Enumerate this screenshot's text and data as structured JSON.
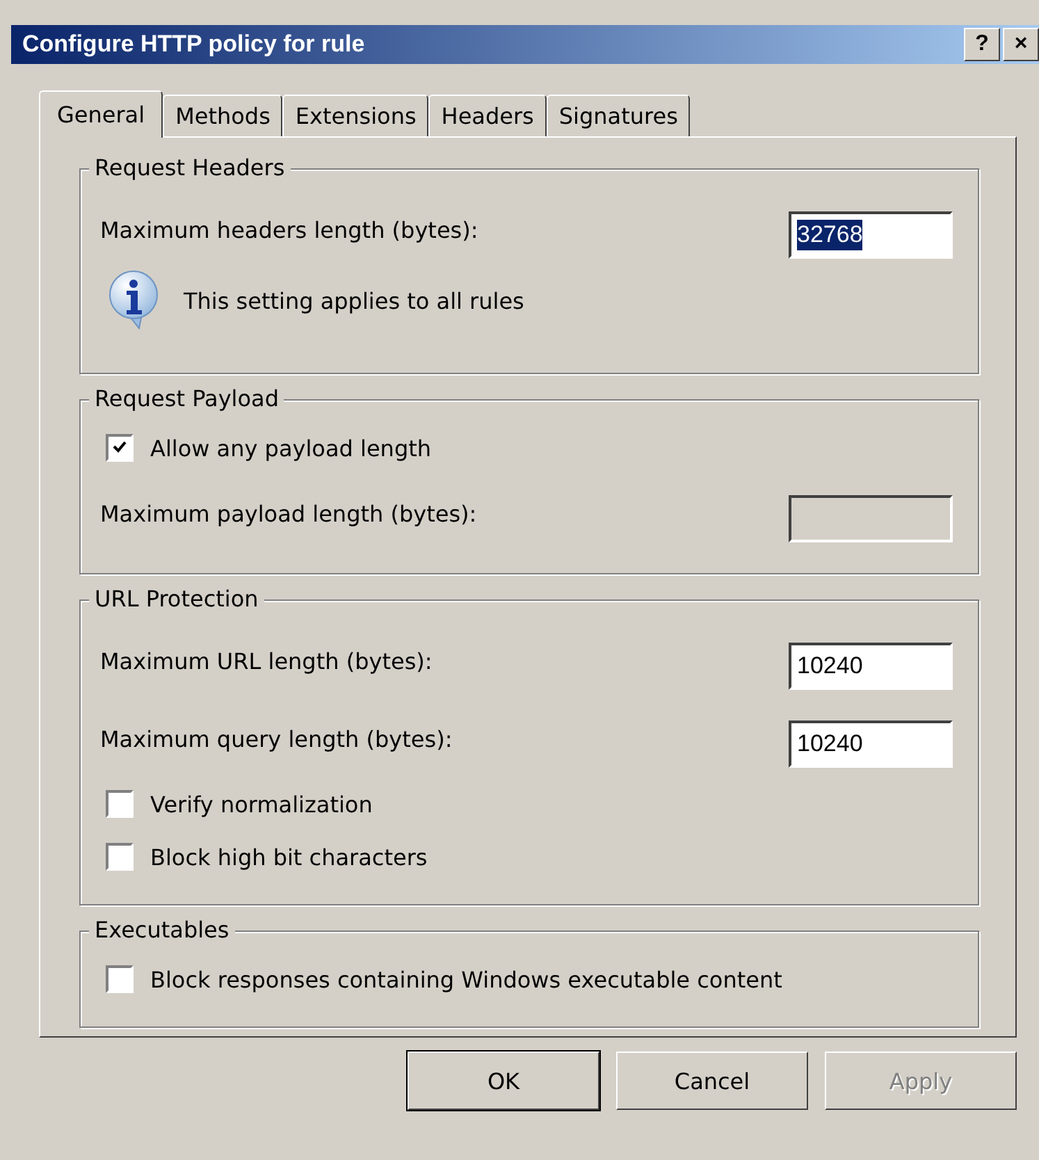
{
  "window": {
    "title": "Configure HTTP policy for rule",
    "title_buttons": [
      "?",
      "×"
    ]
  },
  "tabs": [
    {
      "label": "General",
      "selected": true
    },
    {
      "label": "Methods",
      "selected": false
    },
    {
      "label": "Extensions",
      "selected": false
    },
    {
      "label": "Headers",
      "selected": false
    },
    {
      "label": "Signatures",
      "selected": false
    }
  ],
  "groups": [
    {
      "title": "Request Headers",
      "rows": [
        {
          "kind": "field",
          "label": "Maximum headers length (bytes):",
          "value": "32768",
          "value_selected": true,
          "disabled": false
        },
        {
          "kind": "info",
          "text": "This setting applies to all rules"
        }
      ]
    },
    {
      "title": "Request Payload",
      "rows": [
        {
          "kind": "checkbox",
          "label": "Allow any payload length",
          "checked": true
        },
        {
          "kind": "field",
          "label": "Maximum payload length (bytes):",
          "disabled": true
        }
      ]
    },
    {
      "title": "URL Protection",
      "rows": [
        {
          "kind": "field",
          "label": "Maximum URL length (bytes):",
          "value": "10240",
          "value_selected": false,
          "disabled": false
        },
        {
          "kind": "field",
          "label": "Maximum query length (bytes):",
          "value": "10240",
          "value_selected": false,
          "disabled": false
        },
        {
          "kind": "checkbox",
          "label": "Verify normalization",
          "checked": false
        },
        {
          "kind": "checkbox",
          "label": "Block high bit characters",
          "checked": false
        }
      ]
    },
    {
      "title": "Executables",
      "rows": [
        {
          "kind": "checkbox",
          "label": "Block responses containing Windows executable content",
          "checked": false
        }
      ]
    }
  ],
  "buttons": [
    {
      "label": "OK",
      "default": true,
      "disabled": false
    },
    {
      "label": "Cancel",
      "default": false,
      "disabled": false
    },
    {
      "label": "Apply",
      "default": false,
      "disabled": true
    }
  ]
}
